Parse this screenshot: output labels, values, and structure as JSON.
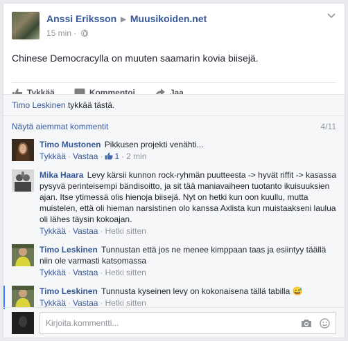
{
  "post": {
    "author": "Anssi Eriksson",
    "target": "Muusikoiden.net",
    "time": "15 min",
    "text": "Chinese Democracylla on muuten saamarin kovia biisejä."
  },
  "actions": {
    "like": "Tykkää",
    "comment": "Kommentoi",
    "share": "Jaa"
  },
  "likes": {
    "name": "Timo Leskinen",
    "suffix": "tykkää tästä."
  },
  "comments_header": {
    "previous": "Näytä aiemmat kommentit",
    "count": "4/11"
  },
  "comments": [
    {
      "name": "Timo Mustonen",
      "text": "Pikkusen projekti venähti...",
      "like": "Tykkää",
      "reply": "Vastaa",
      "likes": "1",
      "time": "2 min"
    },
    {
      "name": "Mika Haara",
      "text": "Levy kärsii kunnon rock-ryhmän puutteesta -> hyvät riffit -> kasassa pysyvä perinteisempi bändisoitto, ja sit tää maniavaiheen tuotanto ikuisuuksien ajan. Itse ytimessä olis hienoja biisejä. Nyt on hetki kun oon kuullu, mutta muistelen, että oli hieman narsistinen olo kanssa Axlista kun muistaakseni laulua oli lähes täysin kokoajan.",
      "like": "Tykkää",
      "reply": "Vastaa",
      "time": "Hetki sitten"
    },
    {
      "name": "Timo Leskinen",
      "text": "Tunnustan että jos ne menee kimppaan taas ja esiintyy täällä niin ole varmasti katsomassa",
      "like": "Tykkää",
      "reply": "Vastaa",
      "time": "Hetki sitten"
    },
    {
      "name": "Timo Leskinen",
      "text": "Tunnusta kyseinen levy on kokonaisena tällä tabilla",
      "emoji": "😅",
      "like": "Tykkää",
      "reply": "Vastaa",
      "time": "Hetki sitten"
    }
  ],
  "compose": {
    "placeholder": "Kirjoita kommentti..."
  },
  "colors": {
    "link": "#365899",
    "muted": "#90949c",
    "highlight": "#4080ff"
  }
}
